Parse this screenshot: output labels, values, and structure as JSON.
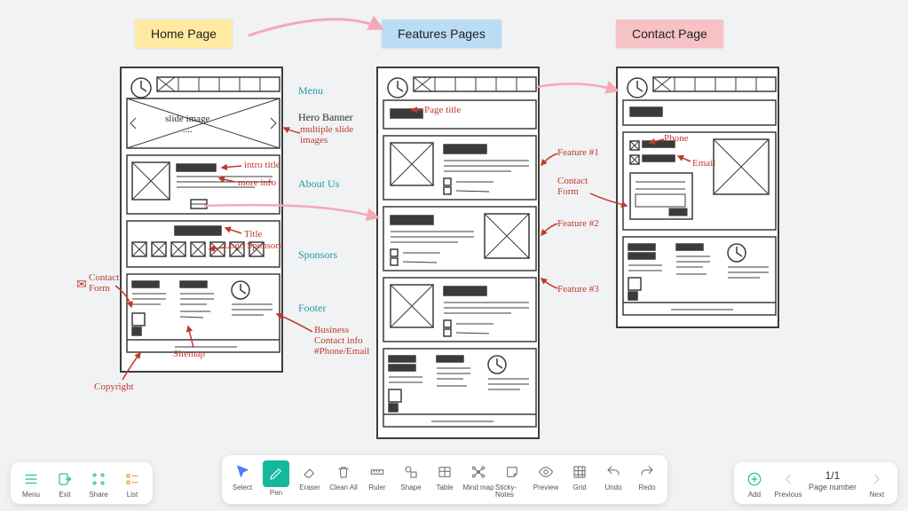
{
  "stickies": {
    "home": {
      "label": "Home Page"
    },
    "features": {
      "label": "Features Pages"
    },
    "contact": {
      "label": "Contact Page"
    }
  },
  "annotations": {
    "menu": "Menu",
    "hero": "Hero Banner",
    "multi_slide": "multiple slide\nimages",
    "slide_image": "slide image\n....",
    "intro_title": "intro title",
    "more_info": "more info",
    "about_us": "About Us",
    "title": "Title",
    "logo_sponsors": "Logo Sponsors",
    "sponsors": "Sponsors",
    "contact_form_small": "Contact\nForm",
    "footer": "Footer",
    "business_contact": "Business\nContact info\n#Phone/Email",
    "sitemap": "Sitemap",
    "copyright": "Copyright",
    "page_title": "Page title",
    "feature1": "Feature #1",
    "feature2": "Feature #2",
    "feature3": "Feature #3",
    "contact_form_big": "Contact\nForm",
    "phone": "Phone",
    "email": "Email"
  },
  "toolbar_left": [
    {
      "id": "menu",
      "label": "Menu"
    },
    {
      "id": "exit",
      "label": "Exit"
    },
    {
      "id": "share",
      "label": "Share"
    },
    {
      "id": "list",
      "label": "List"
    }
  ],
  "toolbar_center": [
    {
      "id": "select",
      "label": "Select"
    },
    {
      "id": "pen",
      "label": "Pen"
    },
    {
      "id": "eraser",
      "label": "Eraser"
    },
    {
      "id": "clean",
      "label": "Clean All"
    },
    {
      "id": "ruler",
      "label": "Ruler"
    },
    {
      "id": "shape",
      "label": "Shape"
    },
    {
      "id": "table",
      "label": "Table"
    },
    {
      "id": "mindmap",
      "label": "Mind map"
    },
    {
      "id": "sticky",
      "label": "Sticky-Notes"
    },
    {
      "id": "preview",
      "label": "Preview"
    },
    {
      "id": "grid",
      "label": "Grid"
    },
    {
      "id": "undo",
      "label": "Undo"
    },
    {
      "id": "redo",
      "label": "Redo"
    }
  ],
  "toolbar_right": {
    "add": "Add",
    "previous": "Previous",
    "pagenum": "1/1",
    "pagenum_label": "Page number",
    "next": "Next"
  }
}
